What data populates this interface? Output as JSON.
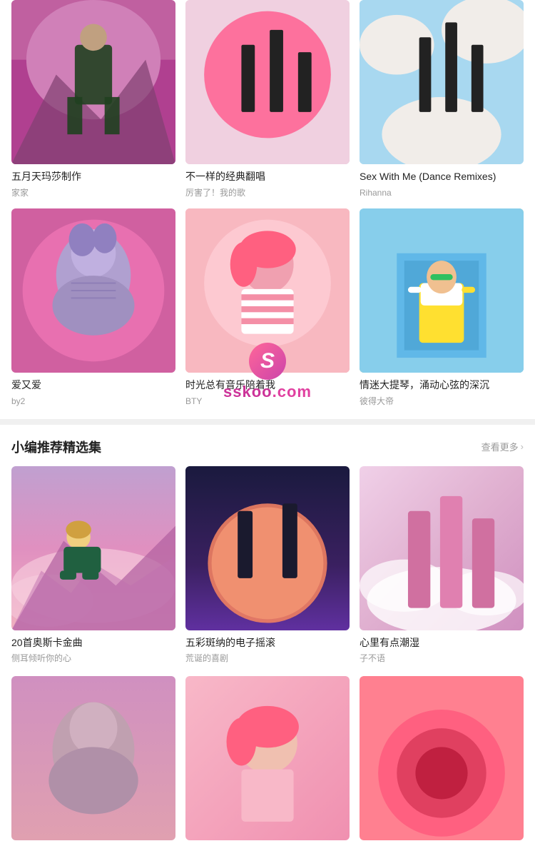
{
  "topGrid": {
    "items": [
      {
        "id": "album-1",
        "title": "五月天玛莎制作",
        "subtitle": "家家",
        "artType": "art-1"
      },
      {
        "id": "album-2",
        "title": "不一样的经典翻唱",
        "subtitle": "厉害了！我的歌",
        "artType": "art-2"
      },
      {
        "id": "album-3",
        "title": "Sex With Me (Dance Remixes)",
        "subtitle": "Rihanna",
        "artType": "art-3"
      },
      {
        "id": "album-4",
        "title": "爱又爱",
        "subtitle": "by2",
        "artType": "art-4"
      },
      {
        "id": "album-5",
        "title": "时光总有音乐陪着我",
        "subtitle": "BTY",
        "artType": "art-5"
      },
      {
        "id": "album-6",
        "title": "情迷大提琴，涌动心弦的深沉",
        "subtitle": "彼得大帝",
        "artType": "art-6"
      }
    ]
  },
  "recommendSection": {
    "title": "小编推荐精选集",
    "seeMore": "查看更多",
    "items": [
      {
        "id": "rec-1",
        "title": "20首奥斯卡金曲",
        "subtitle": "侧耳倾听你的心",
        "artType": "art-7"
      },
      {
        "id": "rec-2",
        "title": "五彩斑纳的电子摇滚",
        "subtitle": "荒诞的喜剧",
        "artType": "art-8"
      },
      {
        "id": "rec-3",
        "title": "心里有点潮湿",
        "subtitle": "子不语",
        "artType": "art-9"
      }
    ]
  },
  "bottomPartialItems": [
    {
      "id": "bot-1",
      "artType": "art-bottom-1"
    },
    {
      "id": "bot-2",
      "artType": "art-bottom-2"
    },
    {
      "id": "bot-3",
      "artType": "art-bottom-3"
    }
  ],
  "watermark": {
    "logo": "S",
    "text": "sskoo",
    "textEnd": ".com"
  }
}
